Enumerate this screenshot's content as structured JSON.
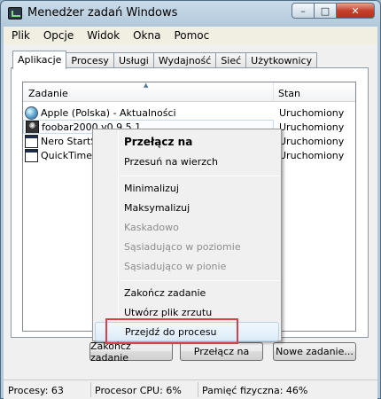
{
  "window": {
    "title": "Menedżer zadań Windows",
    "buttons": {
      "minimize": "–",
      "maximize": "□",
      "close": "✕"
    }
  },
  "menubar": [
    "Plik",
    "Opcje",
    "Widok",
    "Okna",
    "Pomoc"
  ],
  "tabs": [
    {
      "label": "Aplikacje",
      "active": true
    },
    {
      "label": "Procesy"
    },
    {
      "label": "Usługi"
    },
    {
      "label": "Wydajność"
    },
    {
      "label": "Sieć"
    },
    {
      "label": "Użytkownicy"
    }
  ],
  "table": {
    "columns": [
      "Zadanie",
      "Stan"
    ],
    "rows": [
      {
        "task": "Apple (Polska) - Aktualności",
        "status": "Uruchomiony",
        "icon": "globe-icon"
      },
      {
        "task": "foobar2000 v0.9.5.1",
        "status": "Uruchomiony",
        "icon": "foobar-icon"
      },
      {
        "task": "Nero StartS",
        "status": "Uruchomiony",
        "icon": "window-icon"
      },
      {
        "task": "QuickTimeP",
        "status": "Uruchomiony",
        "icon": "window-icon"
      }
    ]
  },
  "buttons": {
    "end_task": "Zakończ zadanie",
    "switch_to": "Przełącz na",
    "new_task": "Nowe zadanie..."
  },
  "context_menu": {
    "items": [
      {
        "label": "Przełącz na",
        "bold": true
      },
      {
        "label": "Przesuń na wierzch"
      },
      {
        "label": "Minimalizuj"
      },
      {
        "label": "Maksymalizuj"
      },
      {
        "label": "Kaskadowo",
        "disabled": true
      },
      {
        "label": "Sąsiadująco w poziomie",
        "disabled": true
      },
      {
        "label": "Sąsiadująco w pionie",
        "disabled": true
      },
      {
        "label": "Zakończ zadanie"
      },
      {
        "label": "Utwórz plik zrzutu"
      },
      {
        "label": "Przejdź do procesu",
        "hovered": true
      }
    ]
  },
  "statusbar": {
    "processes": "Procesy: 63",
    "cpu": "Procesor CPU: 6%",
    "memory": "Pamięć fizyczna: 46%"
  },
  "colors": {
    "highlight_box": "#d6424a",
    "title_bar": "#c9dbe9",
    "close_button": "#c4402c"
  }
}
